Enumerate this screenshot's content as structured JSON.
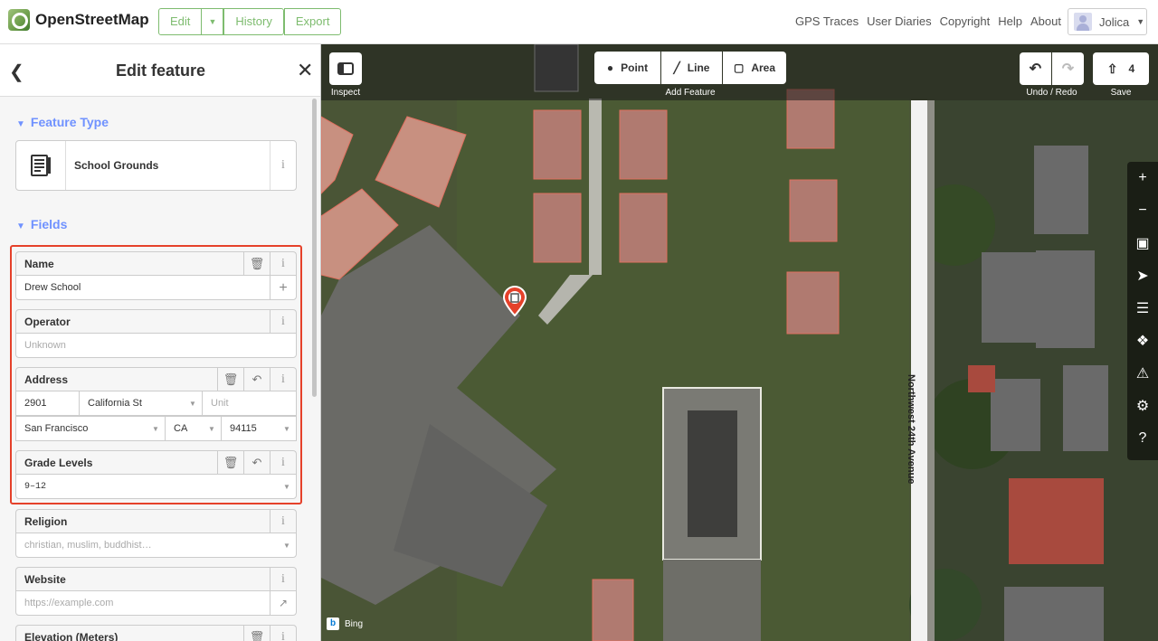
{
  "topnav": {
    "logo_text": "OpenStreetMap",
    "edit_label": "Edit",
    "history_label": "History",
    "export_label": "Export",
    "links": [
      "GPS Traces",
      "User Diaries",
      "Copyright",
      "Help",
      "About"
    ],
    "user_name": "Jolica"
  },
  "sidebar": {
    "title": "Edit feature",
    "feature_type_heading": "Feature Type",
    "preset_name": "School Grounds",
    "fields_heading": "Fields",
    "fields": {
      "name": {
        "label": "Name",
        "value": "Drew School"
      },
      "operator": {
        "label": "Operator",
        "placeholder": "Unknown"
      },
      "address": {
        "label": "Address",
        "housenumber": "2901",
        "street": "California St",
        "unit_placeholder": "Unit",
        "city": "San Francisco",
        "state": "CA",
        "postcode": "94115"
      },
      "grade_levels": {
        "label": "Grade Levels",
        "value": "9–12"
      },
      "religion": {
        "label": "Religion",
        "placeholder": "christian, muslim, buddhist…"
      },
      "website": {
        "label": "Website",
        "placeholder": "https://example.com"
      },
      "elevation": {
        "label": "Elevation (Meters)"
      }
    }
  },
  "map": {
    "inspect_label": "Inspect",
    "point_label": "Point",
    "line_label": "Line",
    "area_label": "Area",
    "add_feature_label": "Add Feature",
    "undo_redo_label": "Undo / Redo",
    "save_count": "4",
    "save_label": "Save",
    "street_label": "Northwest 24th Avenue",
    "imagery_label": "Bing"
  },
  "colors": {
    "osm_green": "#7ebc6f",
    "section_blue": "#7092ff",
    "highlight_red": "#e5412a"
  }
}
